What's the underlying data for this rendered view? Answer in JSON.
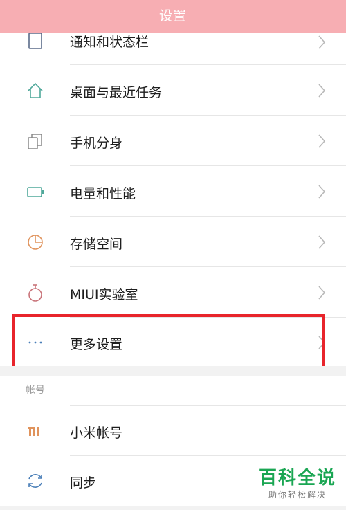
{
  "header": {
    "title": "设置"
  },
  "settings": [
    {
      "label": "通知和状态栏",
      "icon": "notification-icon"
    },
    {
      "label": "桌面与最近任务",
      "icon": "home-icon"
    },
    {
      "label": "手机分身",
      "icon": "dual-apps-icon"
    },
    {
      "label": "电量和性能",
      "icon": "battery-icon"
    },
    {
      "label": "存储空间",
      "icon": "storage-pie-icon"
    },
    {
      "label": "MIUI实验室",
      "icon": "lab-flask-icon"
    },
    {
      "label": "更多设置",
      "icon": "more-dots-icon"
    }
  ],
  "account_section": {
    "title": "帐号",
    "items": [
      {
        "label": "小米帐号",
        "icon": "mi-logo-icon"
      },
      {
        "label": "同步",
        "icon": "sync-icon"
      }
    ]
  },
  "watermark": {
    "title": "百科全说",
    "subtitle": "助你轻松解决"
  },
  "colors": {
    "header_bg": "#f7aeb3",
    "highlight": "#e8242b",
    "icon_teal": "#4fa89a",
    "icon_orange": "#e0935c",
    "watermark_green": "#1aa653"
  }
}
